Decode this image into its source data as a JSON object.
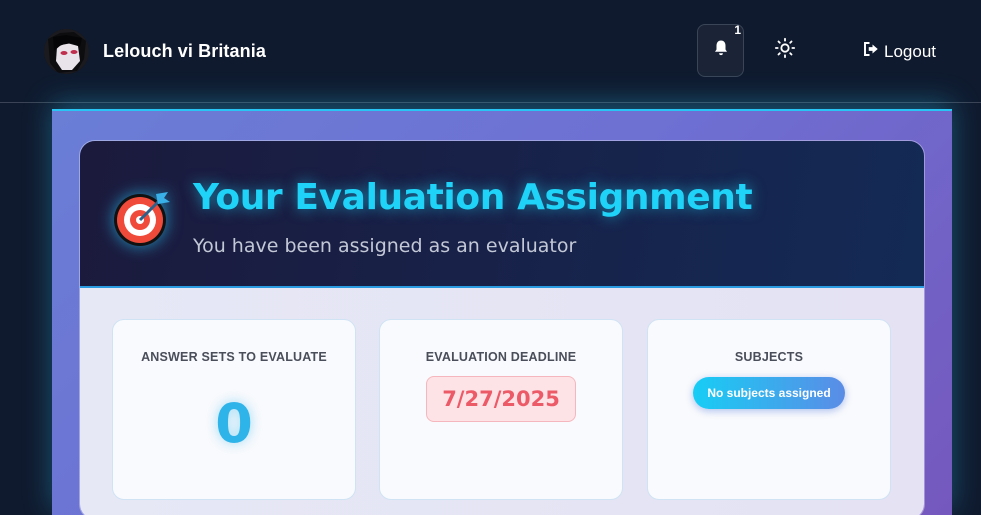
{
  "header": {
    "username": "Lelouch vi Britania",
    "notification_count": "1",
    "logout_label": "Logout"
  },
  "icons": {
    "notifications": "bell-icon",
    "theme": "sun-icon",
    "logout": "logout-icon",
    "assignment": "target-icon"
  },
  "assignment": {
    "title": "Your Evaluation Assignment",
    "subtitle": "You have been assigned as an evaluator",
    "stats": [
      {
        "label": "ANSWER SETS TO EVALUATE",
        "value": "0"
      },
      {
        "label": "EVALUATION DEADLINE",
        "value": "7/27/2025"
      },
      {
        "label": "SUBJECTS",
        "value": "No subjects assigned"
      }
    ]
  },
  "colors": {
    "accent": "#1fd2f7",
    "deadline": "#ec5a68",
    "navbar": "#0f1a2e"
  }
}
